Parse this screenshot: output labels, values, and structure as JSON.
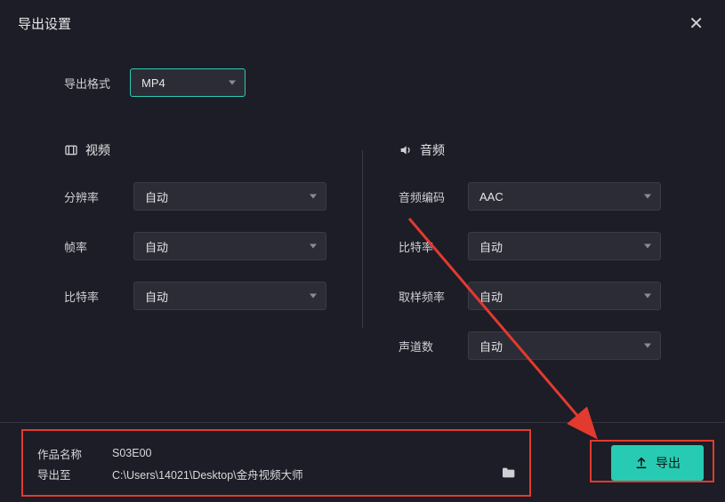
{
  "header": {
    "title": "导出设置"
  },
  "format": {
    "label": "导出格式",
    "value": "MP4"
  },
  "video": {
    "heading": "视频",
    "resolution": {
      "label": "分辨率",
      "value": "自动"
    },
    "framerate": {
      "label": "帧率",
      "value": "自动"
    },
    "bitrate": {
      "label": "比特率",
      "value": "自动"
    }
  },
  "audio": {
    "heading": "音频",
    "codec": {
      "label": "音频编码",
      "value": "AAC"
    },
    "bitrate": {
      "label": "比特率",
      "value": "自动"
    },
    "samplerate": {
      "label": "取样频率",
      "value": "自动"
    },
    "channels": {
      "label": "声道数",
      "value": "自动"
    }
  },
  "output": {
    "name_label": "作品名称",
    "name_value": "S03E00",
    "path_label": "导出至",
    "path_value": "C:\\Users\\14021\\Desktop\\金舟视频大师"
  },
  "export_button": "导出"
}
